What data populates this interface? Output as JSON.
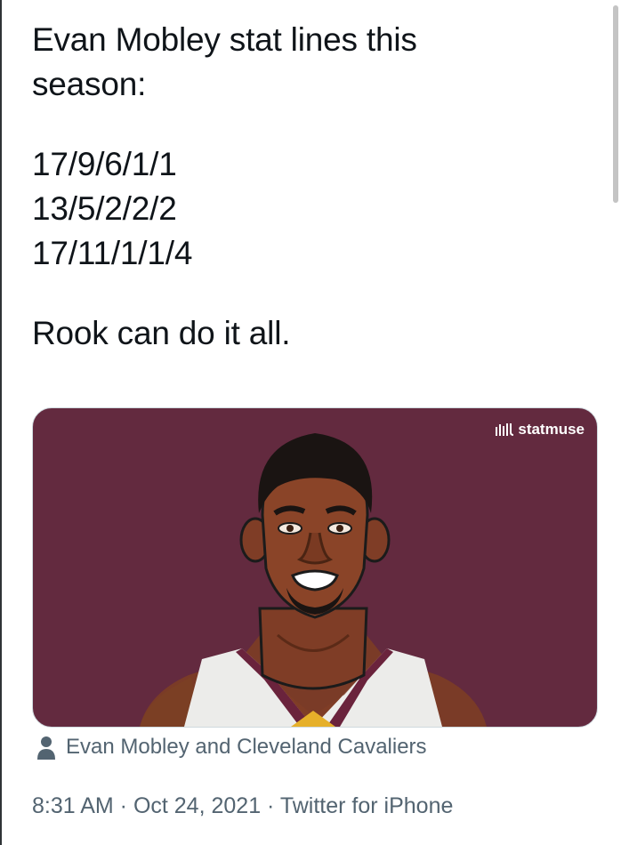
{
  "tweet": {
    "text_lines": [
      "Evan Mobley stat lines this",
      "season:",
      "17/9/6/1/1",
      "13/5/2/2/2",
      "17/11/1/1/4",
      "Rook can do it all."
    ]
  },
  "media": {
    "brand": "statmuse",
    "brand_icon": "statmuse-logo-icon",
    "background_color": "#632a3f"
  },
  "tagged": {
    "icon": "person-icon",
    "text": "Evan Mobley and Cleveland Cavaliers"
  },
  "meta": {
    "timestamp_line": "8:31 AM · Oct 24, 2021 · Twitter for iPhone"
  }
}
